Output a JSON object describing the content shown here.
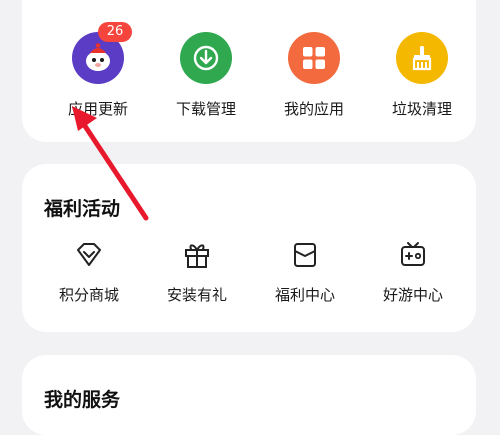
{
  "apps": [
    {
      "label": "应用更新",
      "icon": "app-update-icon",
      "color": "#5b3cc4",
      "badge": "26"
    },
    {
      "label": "下载管理",
      "icon": "download-icon",
      "color": "#2fa84f"
    },
    {
      "label": "我的应用",
      "icon": "grid-icon",
      "color": "#f26a3d"
    },
    {
      "label": "垃圾清理",
      "icon": "broom-icon",
      "color": "#f5b800"
    }
  ],
  "welfare": {
    "title": "福利活动",
    "items": [
      {
        "label": "积分商城",
        "icon": "diamond-icon"
      },
      {
        "label": "安装有礼",
        "icon": "gift-icon"
      },
      {
        "label": "福利中心",
        "icon": "envelope-icon"
      },
      {
        "label": "好游中心",
        "icon": "game-tv-icon"
      }
    ]
  },
  "services": {
    "title": "我的服务"
  },
  "annotation": {
    "arrow_color": "#e8192c"
  }
}
